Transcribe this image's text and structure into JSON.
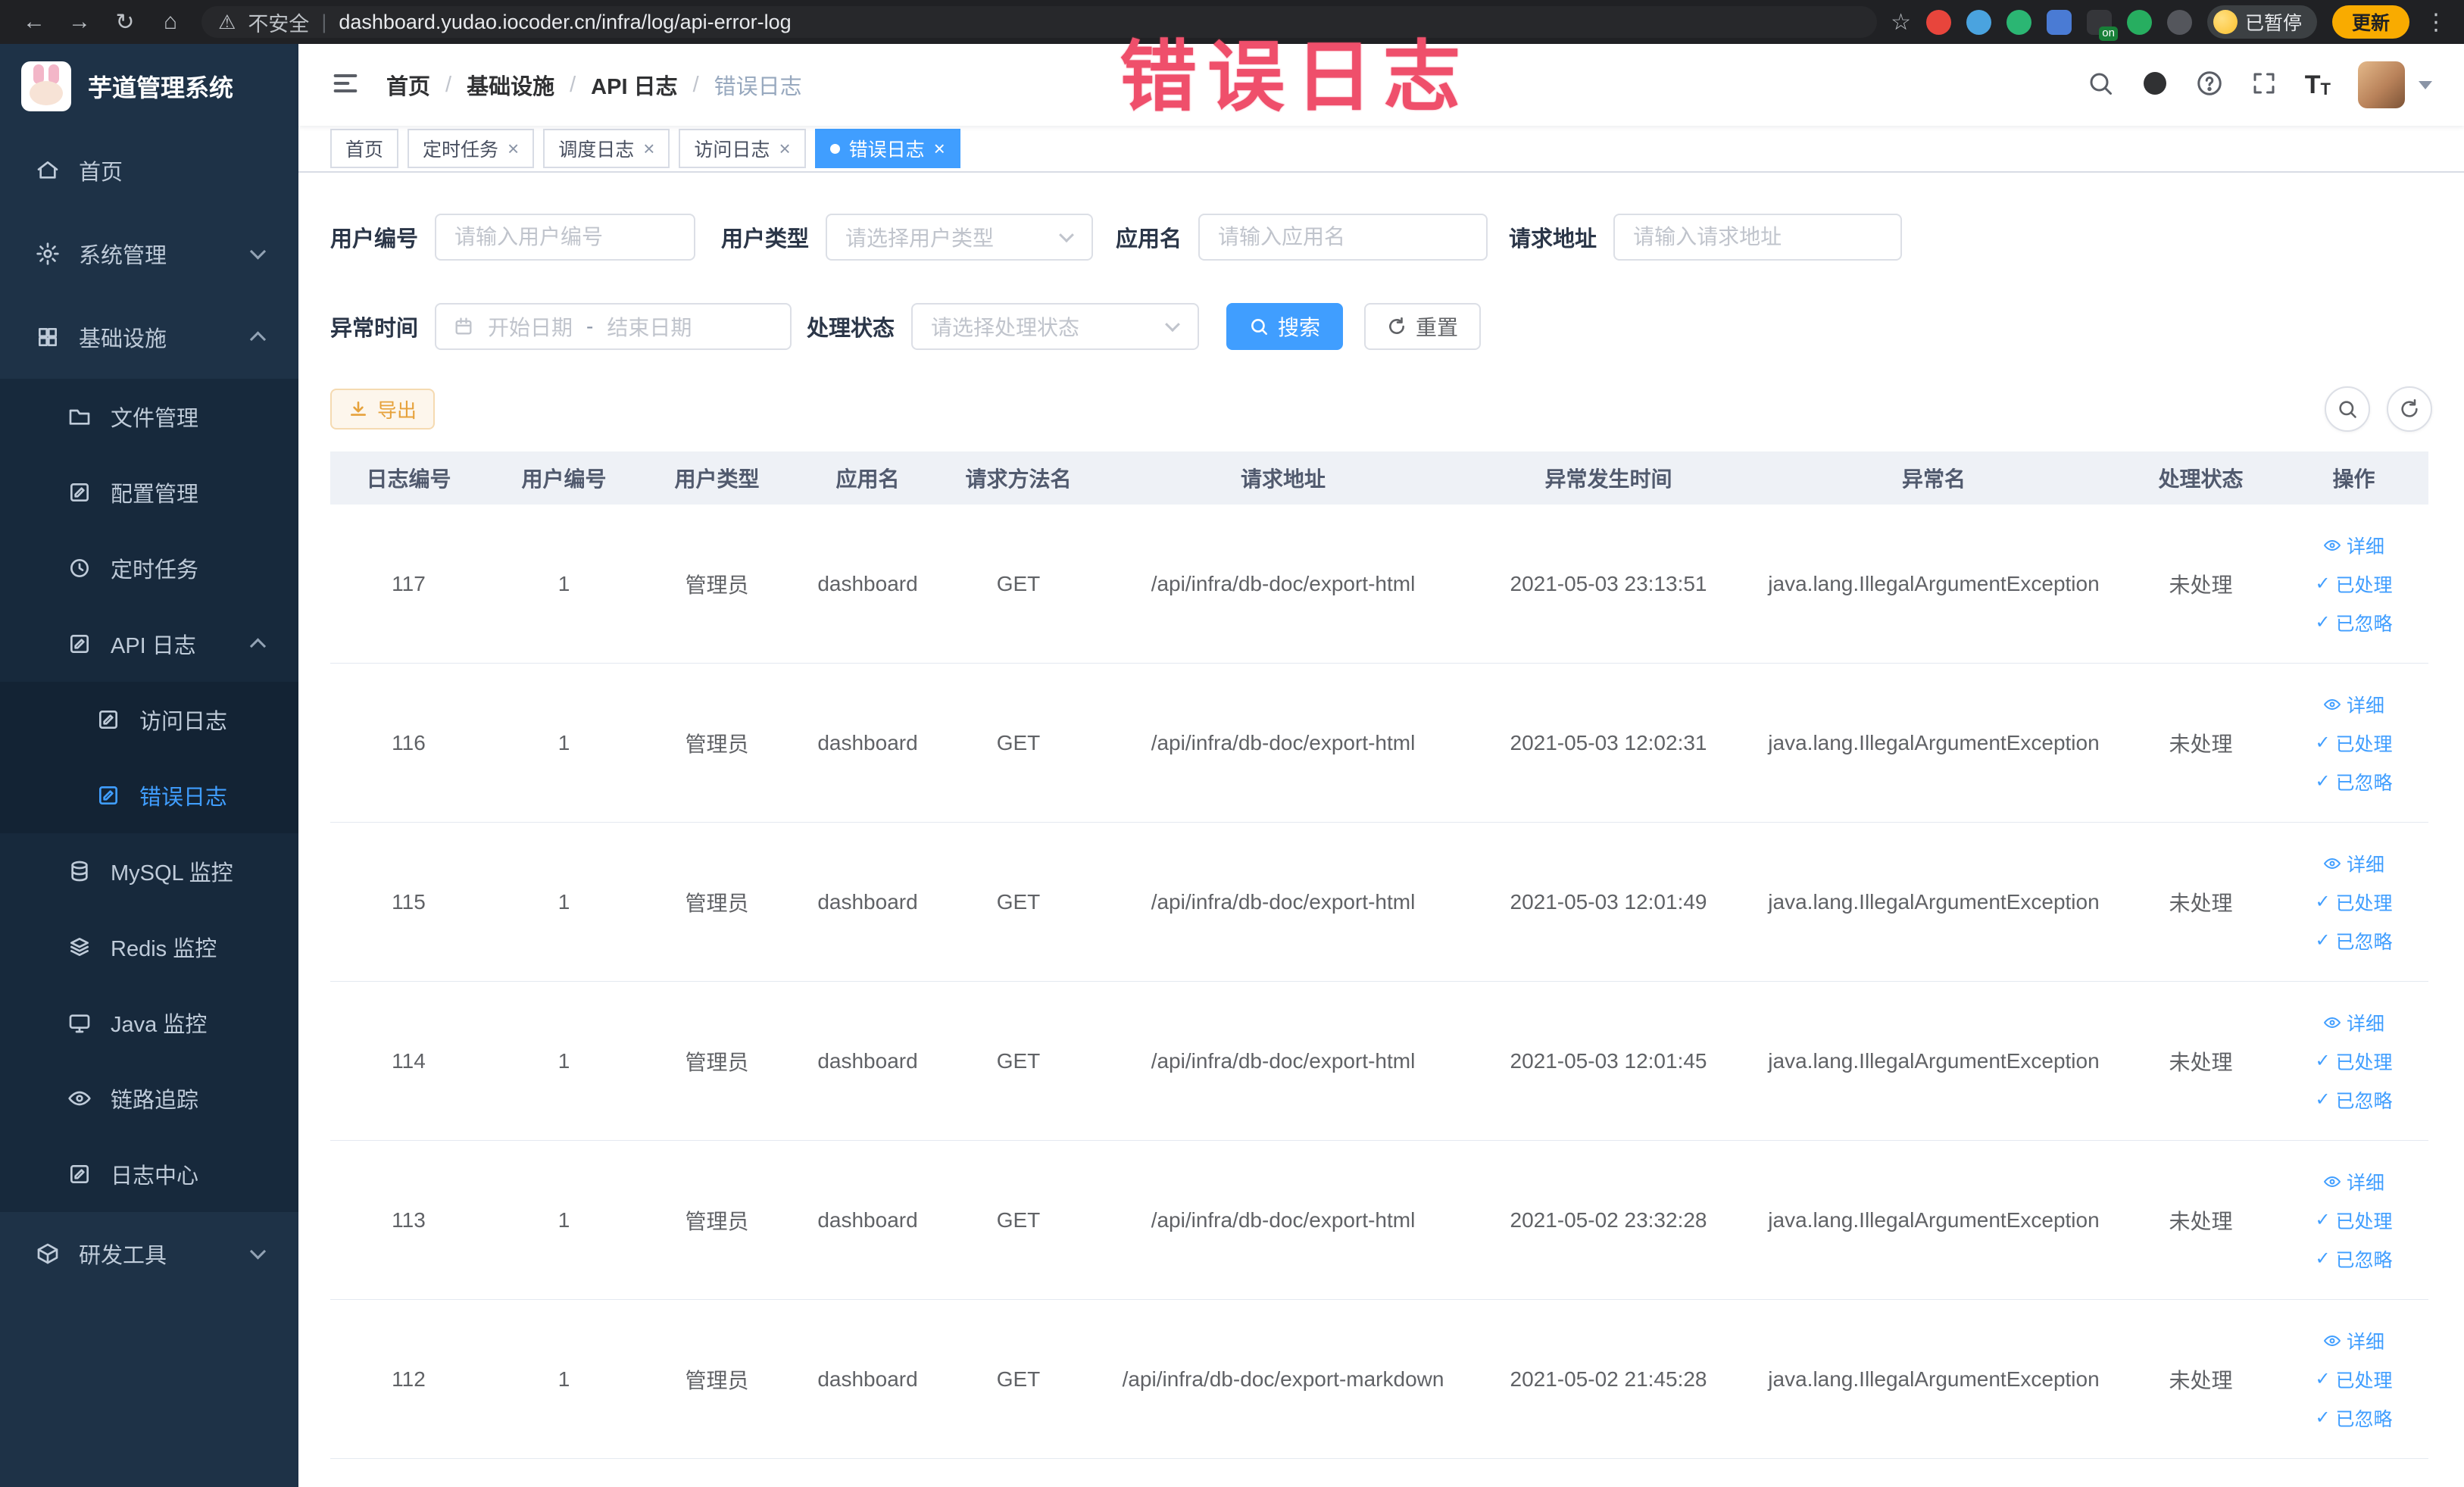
{
  "colors": {
    "primary": "#409eff",
    "warning": "#e6a23c",
    "annotation": "#ef4f6b",
    "sidebar_bg": "#1e3247",
    "chrome_bg": "#202124",
    "table_header_bg": "#eef1f6"
  },
  "icons": {
    "back": "←",
    "forward": "→",
    "reload": "↻",
    "home": "⌂",
    "warning": "⚠",
    "divider": "|",
    "star": "☆",
    "menu_dots": "⋮",
    "close": "×",
    "check": "✓",
    "letter_t": "T"
  },
  "browser": {
    "security_label": "不安全",
    "url": "dashboard.yudao.iocoder.cn/infra/log/api-error-log",
    "extension_badge": "on",
    "paused_label": "已暂停",
    "update_label": "更新"
  },
  "watermark": "错误日志",
  "sidebar": {
    "title": "芋道管理系统",
    "items": [
      {
        "label": "首页",
        "level": 1
      },
      {
        "label": "系统管理",
        "level": 1,
        "arrow": "down"
      },
      {
        "label": "基础设施",
        "level": 1,
        "arrow": "up"
      },
      {
        "label": "文件管理",
        "level": 2
      },
      {
        "label": "配置管理",
        "level": 2
      },
      {
        "label": "定时任务",
        "level": 2
      },
      {
        "label": "API 日志",
        "level": 2,
        "arrow": "up"
      },
      {
        "label": "访问日志",
        "level": 3
      },
      {
        "label": "错误日志",
        "level": 3,
        "active": true
      },
      {
        "label": "MySQL 监控",
        "level": 2
      },
      {
        "label": "Redis 监控",
        "level": 2
      },
      {
        "label": "Java 监控",
        "level": 2
      },
      {
        "label": "链路追踪",
        "level": 2
      },
      {
        "label": "日志中心",
        "level": 2
      },
      {
        "label": "研发工具",
        "level": 1,
        "arrow": "down"
      }
    ]
  },
  "header": {
    "breadcrumb": [
      "首页",
      "基础设施",
      "API 日志",
      "错误日志"
    ]
  },
  "tabs": [
    {
      "label": "首页",
      "closable": false,
      "active": false
    },
    {
      "label": "定时任务",
      "closable": true,
      "active": false
    },
    {
      "label": "调度日志",
      "closable": true,
      "active": false
    },
    {
      "label": "访问日志",
      "closable": true,
      "active": false
    },
    {
      "label": "错误日志",
      "closable": true,
      "active": true
    }
  ],
  "filters": {
    "user_id_label": "用户编号",
    "user_id_placeholder": "请输入用户编号",
    "user_type_label": "用户类型",
    "user_type_placeholder": "请选择用户类型",
    "app_name_label": "应用名",
    "app_name_placeholder": "请输入应用名",
    "request_url_label": "请求地址",
    "request_url_placeholder": "请输入请求地址",
    "exception_time_label": "异常时间",
    "date_start_placeholder": "开始日期",
    "date_separator": "-",
    "date_end_placeholder": "结束日期",
    "process_status_label": "处理状态",
    "process_status_placeholder": "请选择处理状态",
    "search_button": "搜索",
    "reset_button": "重置"
  },
  "toolbar": {
    "export_button": "导出"
  },
  "table": {
    "columns": [
      "日志编号",
      "用户编号",
      "用户类型",
      "应用名",
      "请求方法名",
      "请求地址",
      "异常发生时间",
      "异常名",
      "处理状态",
      "操作"
    ],
    "actions": {
      "detail": "详细",
      "processed": "已处理",
      "ignored": "已忽略"
    },
    "rows": [
      {
        "id": "117",
        "user_id": "1",
        "user_type": "管理员",
        "app": "dashboard",
        "method": "GET",
        "url": "/api/infra/db-doc/export-html",
        "time": "2021-05-03 23:13:51",
        "exception": "java.lang.IllegalArgumentException",
        "status": "未处理"
      },
      {
        "id": "116",
        "user_id": "1",
        "user_type": "管理员",
        "app": "dashboard",
        "method": "GET",
        "url": "/api/infra/db-doc/export-html",
        "time": "2021-05-03 12:02:31",
        "exception": "java.lang.IllegalArgumentException",
        "status": "未处理"
      },
      {
        "id": "115",
        "user_id": "1",
        "user_type": "管理员",
        "app": "dashboard",
        "method": "GET",
        "url": "/api/infra/db-doc/export-html",
        "time": "2021-05-03 12:01:49",
        "exception": "java.lang.IllegalArgumentException",
        "status": "未处理"
      },
      {
        "id": "114",
        "user_id": "1",
        "user_type": "管理员",
        "app": "dashboard",
        "method": "GET",
        "url": "/api/infra/db-doc/export-html",
        "time": "2021-05-03 12:01:45",
        "exception": "java.lang.IllegalArgumentException",
        "status": "未处理"
      },
      {
        "id": "113",
        "user_id": "1",
        "user_type": "管理员",
        "app": "dashboard",
        "method": "GET",
        "url": "/api/infra/db-doc/export-html",
        "time": "2021-05-02 23:32:28",
        "exception": "java.lang.IllegalArgumentException",
        "status": "未处理"
      },
      {
        "id": "112",
        "user_id": "1",
        "user_type": "管理员",
        "app": "dashboard",
        "method": "GET",
        "url": "/api/infra/db-doc/export-markdown",
        "time": "2021-05-02 21:45:28",
        "exception": "java.lang.IllegalArgumentException",
        "status": "未处理"
      }
    ]
  }
}
